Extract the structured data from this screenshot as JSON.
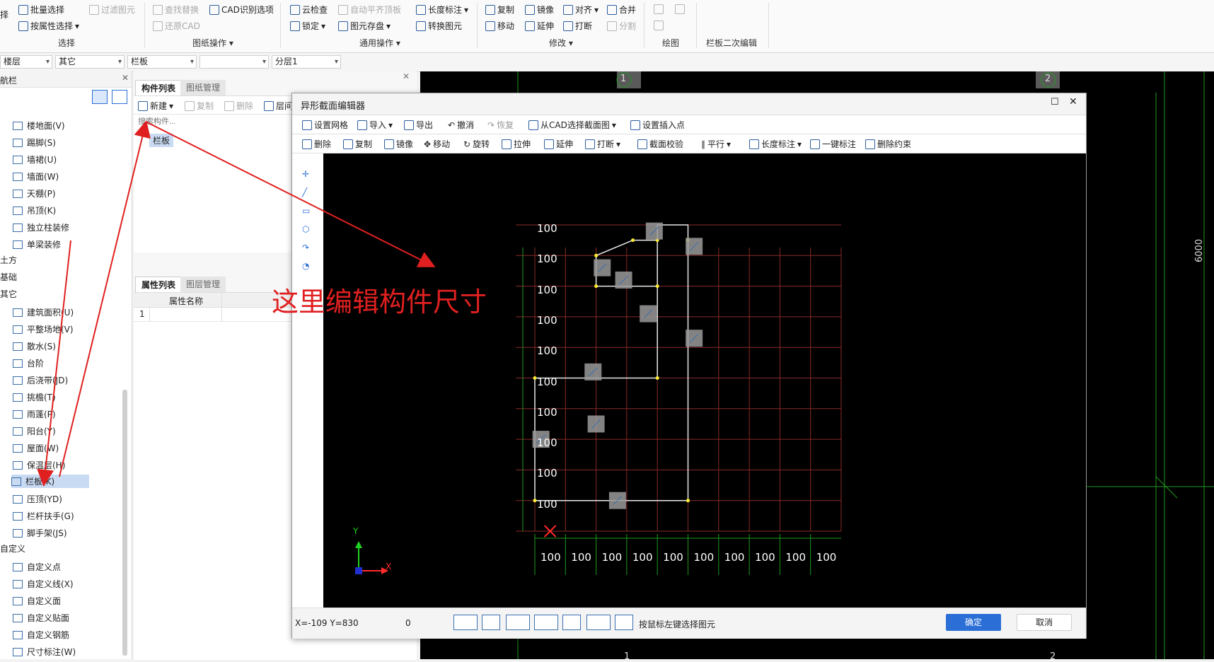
{
  "ribbon": {
    "select_group": {
      "batch_select": "批量选择",
      "filter_elem": "过滤图元",
      "by_attr": "按属性选择",
      "label": "选择",
      "left_cut": "择"
    },
    "drawing_group": {
      "find_replace": "查找替换",
      "cad_options": "CAD识别选项",
      "restore_cad": "还原CAD",
      "label": "图纸操作"
    },
    "common_group": {
      "cloud_check": "云检查",
      "auto_align": "自动平齐顶板",
      "length_mark": "长度标注",
      "lock": "锁定",
      "elem_save": "图元存盘",
      "convert": "转换图元",
      "label": "通用操作"
    },
    "modify_group": {
      "copy": "复制",
      "mirror": "镜像",
      "align": "对齐",
      "merge": "合并",
      "move": "移动",
      "extend": "延伸",
      "break": "打断",
      "split": "分割",
      "label": "修改"
    },
    "draw_group": {
      "label": "绘图"
    },
    "rail_group": {
      "label": "栏板二次编辑"
    }
  },
  "selectors": {
    "s1": "楼层",
    "s2": "其它",
    "s3": "栏板",
    "s4": "",
    "s5": "分层1"
  },
  "nav": {
    "title": "导航栏",
    "items_top": [
      "楼地面(V)",
      "踢脚(S)",
      "墙裙(U)",
      "墙面(W)",
      "天棚(P)",
      "吊顶(K)",
      "独立柱装修",
      "单梁装修"
    ],
    "cat_earth": "土方",
    "cat_found": "基础",
    "cat_other": "其它",
    "items_other": [
      "建筑面积(U)",
      "平整场地(V)",
      "散水(S)",
      "台阶",
      "后浇带(JD)",
      "挑檐(T)",
      "雨蓬(P)",
      "阳台(Y)",
      "屋面(W)",
      "保温层(H)",
      "栏板(K)",
      "压顶(YD)",
      "栏杆扶手(G)",
      "脚手架(JS)"
    ],
    "cat_custom": "自定义",
    "items_custom": [
      "自定义点",
      "自定义线(X)",
      "自定义面",
      "自定义贴面",
      "自定义钢筋",
      "尺寸标注(W)"
    ]
  },
  "mid": {
    "tab_comp": "构件列表",
    "tab_drawing": "图纸管理",
    "new": "新建",
    "copy": "复制",
    "delete": "删除",
    "layer_copy": "层间",
    "search_placeholder": "搜索构件...",
    "component": "栏板",
    "tab_props": "属性列表",
    "tab_layers": "图层管理",
    "prop_header": "属性名称",
    "row1": "1"
  },
  "annotation": "这里编辑构件尺寸",
  "canvas": {
    "axis1": "1",
    "axis2": "2",
    "dim": "6000"
  },
  "dialog": {
    "title": "异形截面编辑器",
    "tb1": {
      "grid": "设置网格",
      "import": "导入",
      "export": "导出",
      "undo": "撤消",
      "redo": "恢复",
      "from_cad": "从CAD选择截面图",
      "insert_pt": "设置插入点"
    },
    "tb2": {
      "delete": "删除",
      "copy": "复制",
      "mirror": "镜像",
      "move": "移动",
      "rotate": "旋转",
      "stretch": "拉伸",
      "extend": "延伸",
      "break": "打断",
      "check": "截面校验",
      "parallel": "平行",
      "length": "长度标注",
      "one_key": "一键标注",
      "del_constraint": "删除约束"
    },
    "row_labels": [
      "100",
      "100",
      "100",
      "100",
      "100",
      "100",
      "100",
      "100",
      "100",
      "100"
    ],
    "col_labels": [
      "100",
      "100",
      "100",
      "100",
      "100",
      "100",
      "100",
      "100",
      "100",
      "100"
    ],
    "coords": "X=-109 Y=830",
    "coord_val": "0",
    "hint": "按鼠标左键选择图元",
    "ok": "确定",
    "cancel": "取消",
    "axis_x": "X",
    "axis_y": "Y"
  },
  "colors": {
    "accent": "#2b6fd6",
    "annot": "#e02020",
    "grid": "#8a2a2a",
    "dim": "#1e9a1e"
  }
}
